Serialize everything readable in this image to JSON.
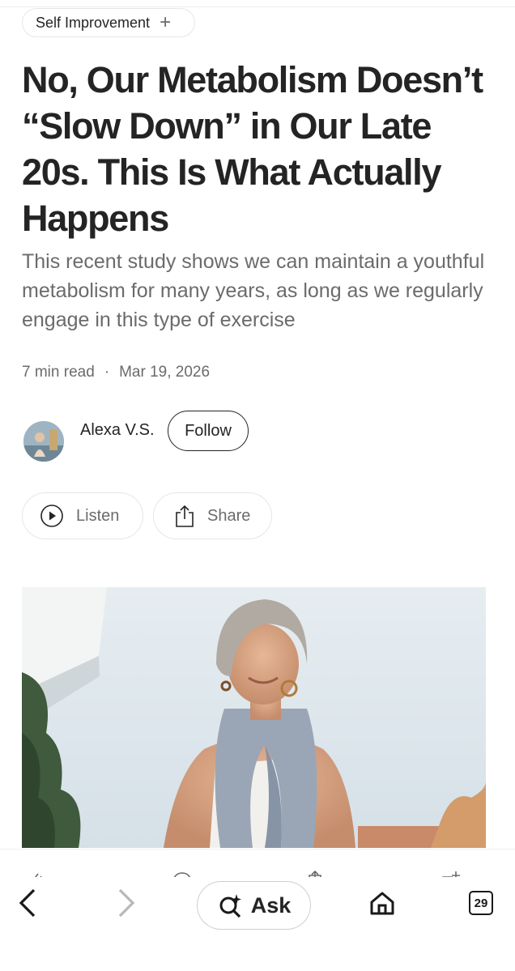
{
  "tag": {
    "label": "Self Improvement"
  },
  "article": {
    "title": "No, Our Metabolism Doesn’t “Slow Down” in Our Late 20s. This Is What Actually Happens",
    "subtitle": "This recent study shows we can maintain a youthful metabolism for many years, as long as we regularly engage in this type of exercise",
    "read_time": "7 min read",
    "date": "Mar 19, 2026"
  },
  "author": {
    "name": "Alexa V.S.",
    "follow_label": "Follow"
  },
  "actions": {
    "listen_label": "Listen",
    "share_label": "Share"
  },
  "hero_image": {
    "icon": "woman-portrait-photo"
  },
  "nav": {
    "ask_label": "Ask",
    "tab_count": "29"
  },
  "colors": {
    "text": "#242424",
    "muted": "#6b6b6b",
    "border": "#e6e6e6"
  }
}
